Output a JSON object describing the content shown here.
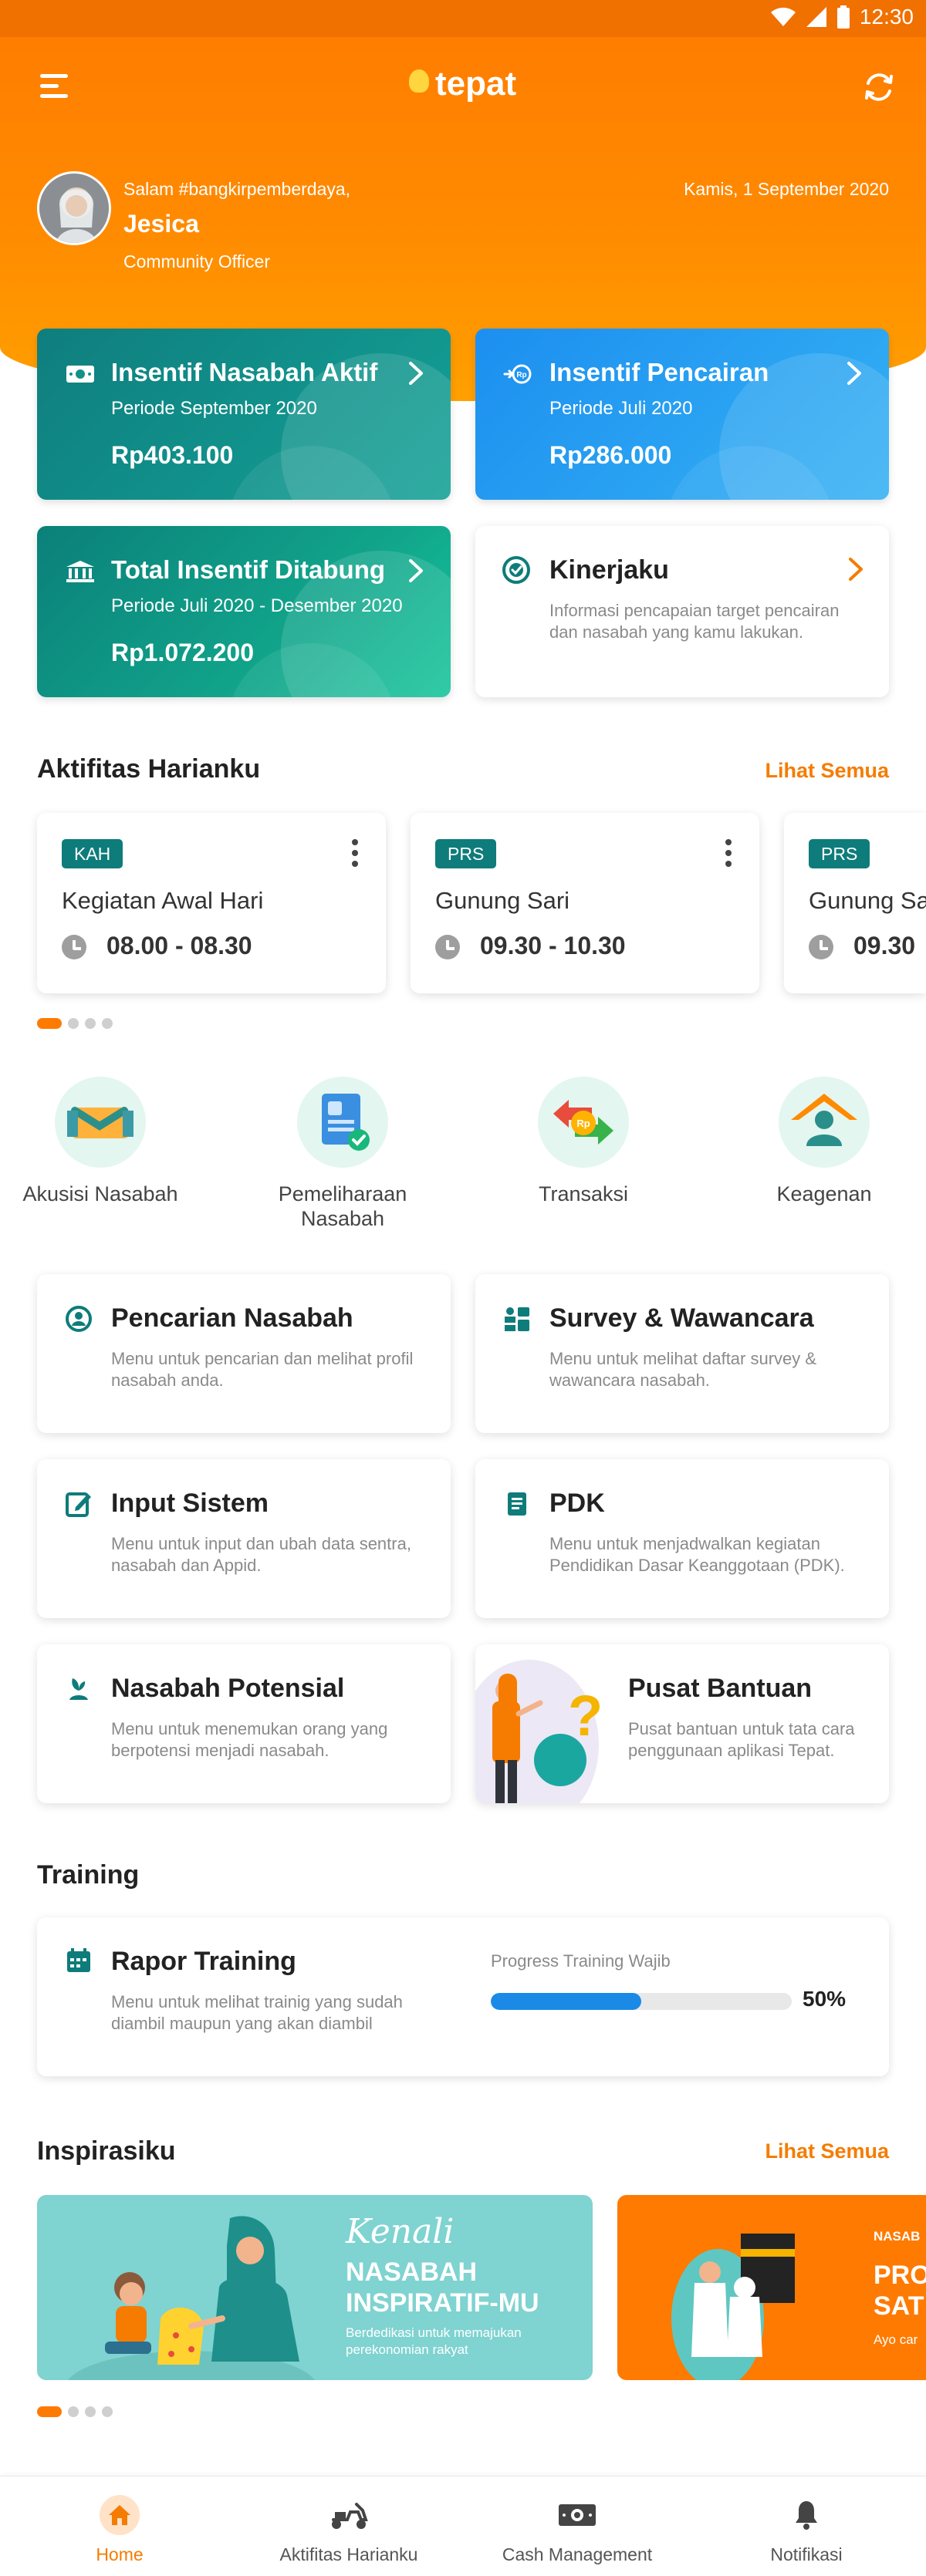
{
  "status_bar": {
    "time": "12:30"
  },
  "app": {
    "logo_text": "tepat"
  },
  "profile": {
    "greeting": "Salam #bangkirpemberdaya,",
    "name": "Jesica",
    "role": "Community Officer",
    "date": "Kamis, 1 September 2020"
  },
  "incentives": [
    {
      "title": "Insentif Nasabah Aktif",
      "period": "Periode September 2020",
      "value": "Rp403.100",
      "icon": "money-icon"
    },
    {
      "title": "Insentif Pencairan",
      "period": "Periode Juli 2020",
      "value": "Rp286.000",
      "icon": "disbursement-icon"
    },
    {
      "title": "Total Insentif Ditabung",
      "period": "Periode Juli 2020 - Desember 2020",
      "value": "Rp1.072.200",
      "icon": "bank-icon"
    }
  ],
  "kinerjaku": {
    "title": "Kinerjaku",
    "desc": "Informasi pencapaian target pencairan dan nasabah yang kamu lakukan."
  },
  "activities": {
    "title": "Aktifitas Harianku",
    "see_all": "Lihat Semua",
    "items": [
      {
        "tag": "KAH",
        "name": "Kegiatan Awal Hari",
        "time": "08.00 - 08.30"
      },
      {
        "tag": "PRS",
        "name": "Gunung Sari",
        "time": "09.30 - 10.30"
      },
      {
        "tag": "PRS",
        "name": "Gunung Sari",
        "time": "09.30"
      }
    ]
  },
  "features": [
    {
      "label": "Akusisi Nasabah",
      "icon": "handshake-icon"
    },
    {
      "label": "Pemeliharaan Nasabah",
      "icon": "profile-card-icon"
    },
    {
      "label": "Transaksi",
      "icon": "exchange-icon"
    },
    {
      "label": "Keagenan",
      "icon": "agent-house-icon"
    }
  ],
  "menus": [
    {
      "title": "Pencarian Nasabah",
      "desc": "Menu untuk pencarian dan melihat profil nasabah anda.",
      "icon": "person-search-icon"
    },
    {
      "title": "Survey & Wawancara",
      "desc": "Menu untuk melihat daftar survey & wawancara nasabah.",
      "icon": "survey-icon"
    },
    {
      "title": "Input Sistem",
      "desc": "Menu untuk input dan ubah data sentra, nasabah dan Appid.",
      "icon": "edit-icon"
    },
    {
      "title": "PDK",
      "desc": "Menu untuk menjadwalkan kegiatan Pendidikan Dasar Keanggotaan (PDK).",
      "icon": "document-icon"
    },
    {
      "title": "Nasabah Potensial",
      "desc": "Menu untuk menemukan orang yang berpotensi menjadi nasabah.",
      "icon": "plant-person-icon"
    },
    {
      "title": "Pusat Bantuan",
      "desc": "Pusat bantuan untuk tata cara penggunaan aplikasi Tepat.",
      "icon": "help-illustration"
    }
  ],
  "training": {
    "section_title": "Training",
    "title": "Rapor Training",
    "desc": "Menu untuk melihat trainig yang sudah diambil maupun yang akan diambil",
    "progress_label": "Progress Training Wajib",
    "progress_value": 50,
    "progress_text": "50%"
  },
  "inspirasi": {
    "title": "Inspirasiku",
    "see_all": "Lihat Semua",
    "banners": [
      {
        "script": "Kenali",
        "headline": "NASABAH INSPIRATIF-MU",
        "sub": "Berdedikasi untuk memajukan perekonomian rakyat"
      },
      {
        "kicker": "NASAB",
        "headline": "PRO SAT",
        "sub": "Ayo car"
      }
    ]
  },
  "bottom_nav": [
    {
      "label": "Home",
      "icon": "home-icon",
      "active": true
    },
    {
      "label": "Aktifitas Harianku",
      "icon": "scooter-icon",
      "active": false
    },
    {
      "label": "Cash Management",
      "icon": "cash-icon",
      "active": false
    },
    {
      "label": "Notifikasi",
      "icon": "bell-icon",
      "active": false
    }
  ],
  "colors": {
    "primary_orange": "#ff7b00",
    "teal": "#0e7c7a",
    "blue": "#1c8ff0",
    "accent_orange": "#f57c00"
  }
}
